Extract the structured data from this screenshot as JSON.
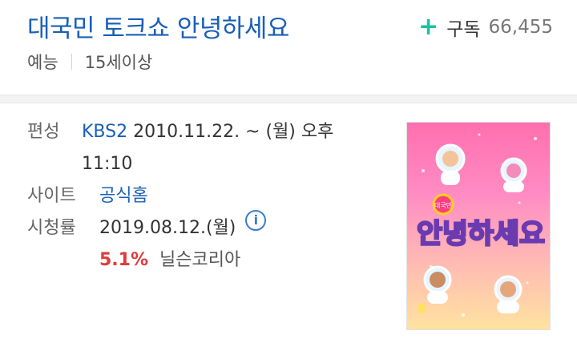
{
  "header": {
    "title": "대국민 토크쇼 안녕하세요",
    "subscribe": {
      "icon": "plus-icon",
      "plus": "+",
      "label": "구독",
      "count": "66,455"
    },
    "genre": "예능",
    "age_rating": "15세이상"
  },
  "details": {
    "schedule": {
      "label": "편성",
      "channel": "KBS2",
      "text": "2010.11.22. ~ (월) 오후",
      "text_cont": "11:10"
    },
    "site": {
      "label": "사이트",
      "link_text": "공식홈"
    },
    "ratings": {
      "label": "시청률",
      "date": "2019.08.12.(월)",
      "info_icon": "info-icon",
      "info_glyph": "i",
      "percent": "5.1%",
      "source": "닐슨코리아"
    }
  },
  "poster": {
    "logo_small": "대국민",
    "logo_text": "안녕하세요",
    "colors": {
      "top": "#ff6fae",
      "bottom": "#ffe3a0",
      "logo_fill": "#ffd21f"
    }
  },
  "colors": {
    "title_blue": "#1a5fb8",
    "accent_green": "#19c3a0",
    "rating_red": "#e03a3a"
  }
}
